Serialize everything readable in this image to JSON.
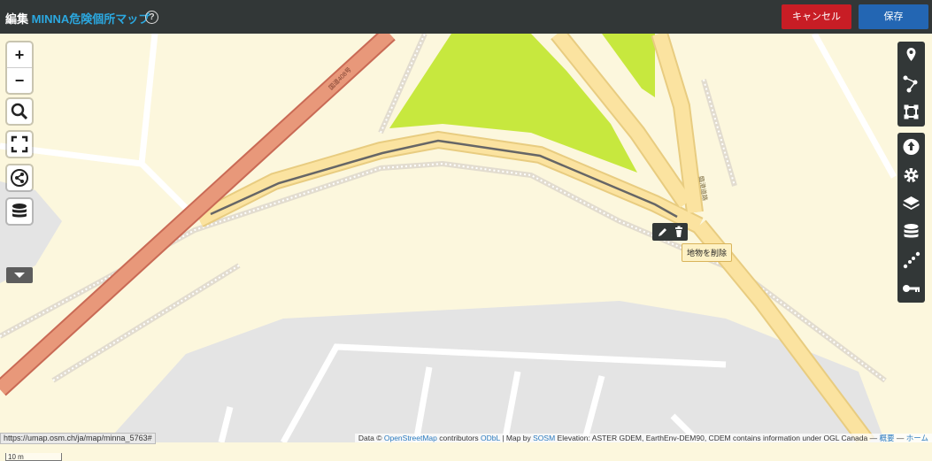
{
  "topbar": {
    "edit_label": "編集",
    "map_name": "MINNA危険個所マップ",
    "help_label": "?",
    "cancel_label": "キャンセル",
    "save_label": "保存"
  },
  "left_controls": {
    "zoom_in": "+",
    "zoom_out": "−",
    "icons": [
      "search-icon",
      "fullscreen-icon",
      "share-icon",
      "data-layers-icon",
      "more-controls-icon"
    ]
  },
  "right_toolbar": {
    "edit_tools": [
      "draw-marker-icon",
      "draw-polyline-icon",
      "draw-polygon-icon"
    ],
    "settings_tools": [
      "import-data-icon",
      "map-settings-icon",
      "manage-layers-icon",
      "data-layers-icon",
      "tile-layers-icon",
      "permissions-key-icon"
    ]
  },
  "feature_toolbar": {
    "icons": [
      "pencil-icon",
      "trash-icon"
    ],
    "tooltip": "地物を削除"
  },
  "map_labels": {
    "road_label_a": "国道408号",
    "road_label_b": "臨港道路"
  },
  "scale": {
    "label": "10 m"
  },
  "status_url": "https://umap.osm.ch/ja/map/minna_5763#",
  "attribution": {
    "data_prefix": "Data ©",
    "osm": "OpenStreetMap",
    "contributors": "contributors",
    "odbl": "ODbL",
    "map_by": "| Map by",
    "sosm": "SOSM",
    "elevation": "Elevation: ASTER GDEM, EarthEnv-DEM90, CDEM contains information under OGL Canada —",
    "about": "概要",
    "sep": "—",
    "home": "ホーム"
  },
  "colors": {
    "topbar_bg": "#323737",
    "map_name": "#2ba8e0",
    "cancel": "#c81d25",
    "save": "#2366b3",
    "land": "#fcf7dd",
    "grass": "#c7e83e",
    "primary_road": "#e8987a",
    "secondary_road": "#fbe3a0",
    "drawn_line": "#666666"
  }
}
